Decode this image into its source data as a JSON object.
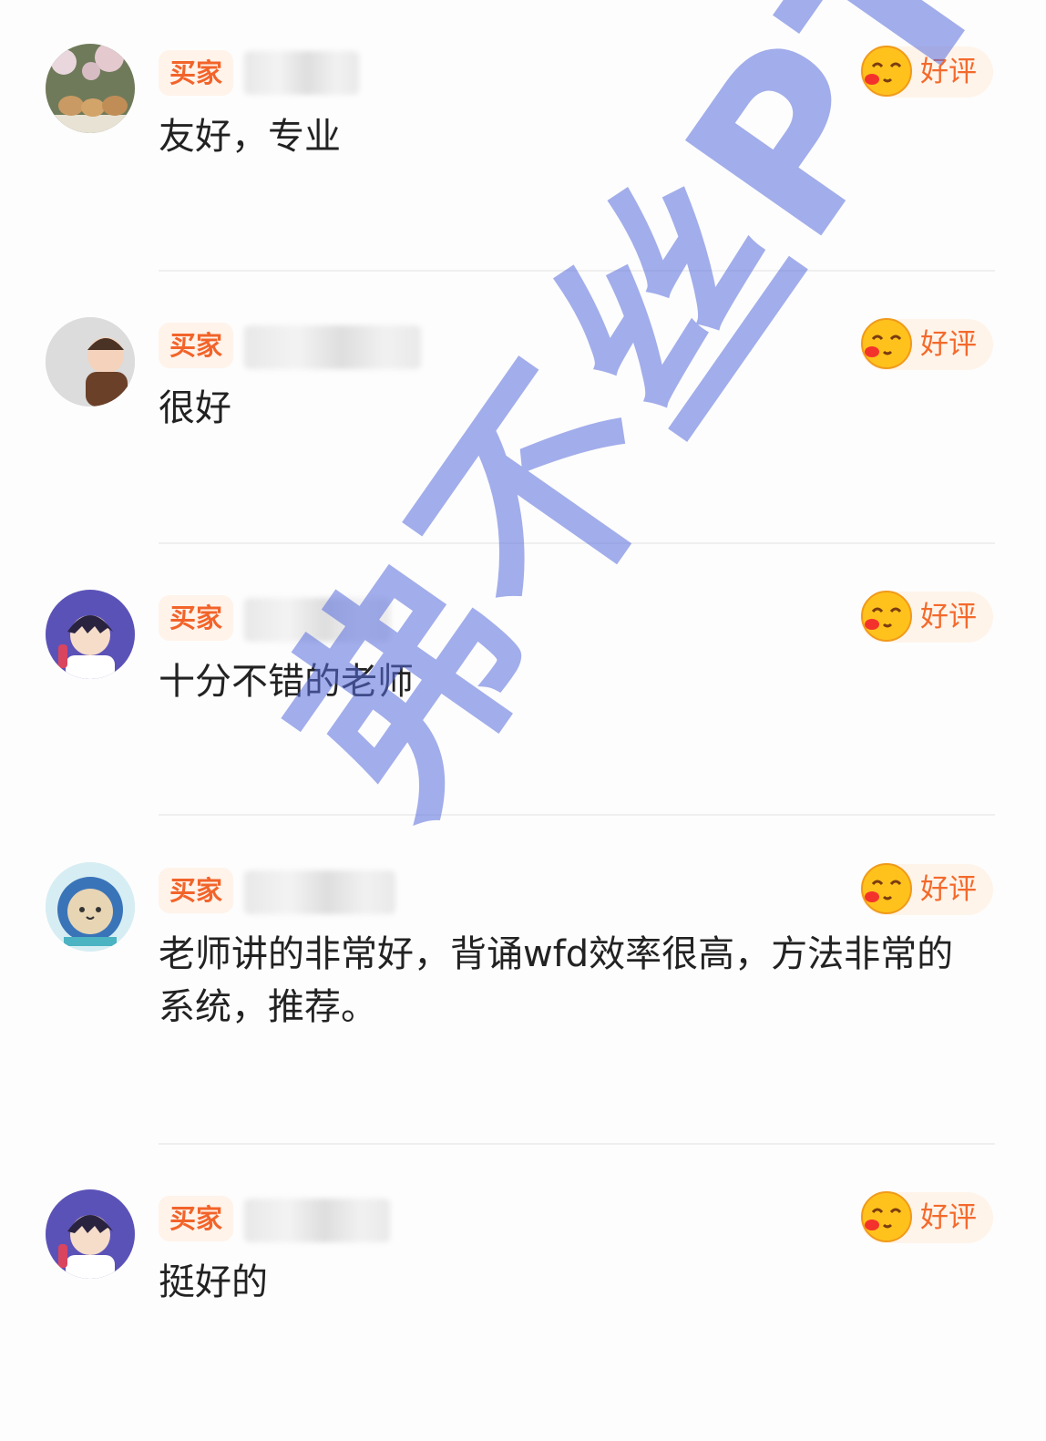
{
  "reviews": [
    {
      "badge": "买家",
      "rating": "好评",
      "text": "友好，专业",
      "avatar_icon": "rabbits-photo-avatar"
    },
    {
      "badge": "买家",
      "rating": "好评",
      "text": "很好",
      "avatar_icon": "baby-photo-avatar"
    },
    {
      "badge": "买家",
      "rating": "好评",
      "text": "十分不错的老师",
      "avatar_icon": "anime-boy-avatar"
    },
    {
      "badge": "买家",
      "rating": "好评",
      "text": "老师讲的非常好，背诵wfd效率很高，方法非常的系统，推荐。",
      "avatar_icon": "cat-astronaut-avatar"
    },
    {
      "badge": "买家",
      "rating": "好评",
      "text": "挺好的",
      "avatar_icon": "anime-boy-avatar"
    }
  ],
  "watermark": "弗不丝PTE",
  "colors": {
    "badge_text": "#f2642a",
    "badge_bg": "#fff3ea",
    "watermark": "#586cdc"
  }
}
